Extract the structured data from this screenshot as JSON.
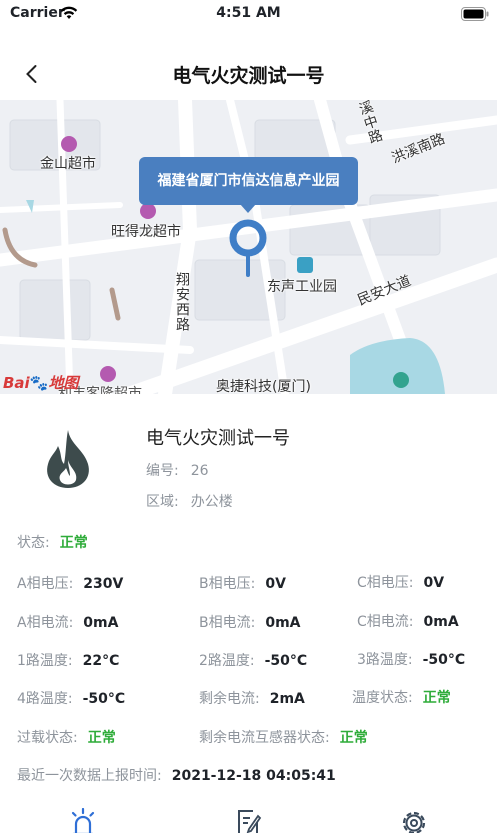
{
  "status_bar": {
    "carrier": "Carrier",
    "time": "4:51 AM"
  },
  "nav": {
    "title": "电气火灾测试一号",
    "back_icon": "chevron-left-icon"
  },
  "map": {
    "callout": "福建省厦门市信达信息产业园",
    "labels": {
      "jinshan": "金山超市",
      "wangdelong": "旺得龙超市",
      "dongsheng": "东声工业园",
      "xiangan_west": "翔安西路",
      "minan": "民安大道",
      "hongxi_south": "洪溪南路",
      "xizhong": "溪中路",
      "aojie": "奥捷科技(厦门)",
      "partial_supermarket": "利丰客隆超市"
    },
    "logo": "Bai",
    "logo_suffix": "地图",
    "colors": {
      "callout": "#4a7fc0",
      "pin": "#3f7ec7"
    }
  },
  "device": {
    "icon": "fire-icon",
    "name": "电气火灾测试一号",
    "number_label": "编号:",
    "number": "26",
    "area_label": "区域:",
    "area": "办公楼"
  },
  "status": {
    "label": "状态:",
    "value": "正常"
  },
  "readings": {
    "a_voltage": {
      "label": "A相电压:",
      "value": "230V"
    },
    "b_voltage": {
      "label": "B相电压:",
      "value": "0V"
    },
    "c_voltage": {
      "label": "C相电压:",
      "value": "0V"
    },
    "a_current": {
      "label": "A相电流:",
      "value": "0mA"
    },
    "b_current": {
      "label": "B相电流:",
      "value": "0mA"
    },
    "c_current": {
      "label": "C相电流:",
      "value": "0mA"
    },
    "temp1": {
      "label": "1路温度:",
      "value": "22°C"
    },
    "temp2": {
      "label": "2路温度:",
      "value": "-50°C"
    },
    "temp3": {
      "label": "3路温度:",
      "value": "-50°C"
    },
    "temp4": {
      "label": "4路温度:",
      "value": "-50°C"
    },
    "residual_current": {
      "label": "剩余电流:",
      "value": "2mA"
    },
    "temp_status": {
      "label": "温度状态:",
      "value": "正常"
    },
    "overload_status": {
      "label": "过载状态:",
      "value": "正常"
    },
    "residual_sensor_status": {
      "label": "剩余电流互感器状态:",
      "value": "正常"
    },
    "last_report": {
      "label": "最近一次数据上报时间:",
      "value": "2021-12-18 04:05:41"
    }
  },
  "tabbar": {
    "tabs": [
      {
        "icon": "alarm-light-icon"
      },
      {
        "icon": "edit-document-icon"
      },
      {
        "icon": "gear-icon"
      }
    ],
    "colors": {
      "active": "#2f6fd6"
    }
  }
}
